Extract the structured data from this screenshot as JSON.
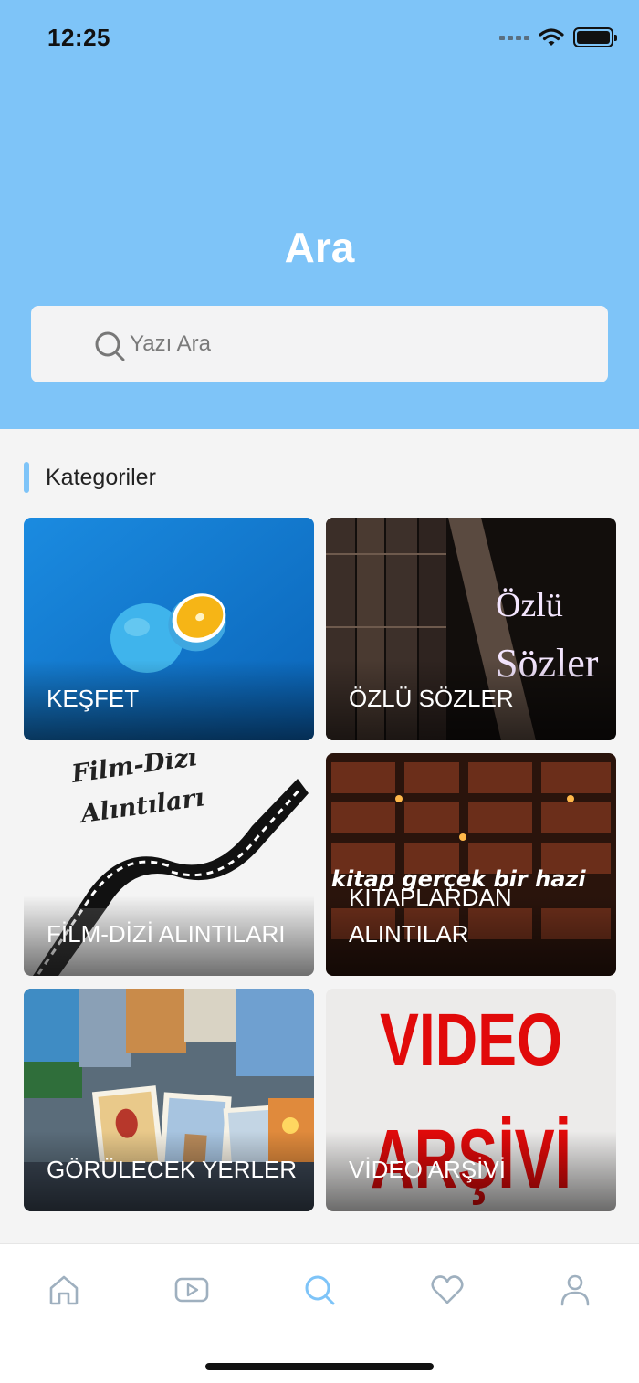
{
  "status_bar": {
    "time": "12:25"
  },
  "header": {
    "title": "Ara"
  },
  "search": {
    "placeholder": "Yazı Ara"
  },
  "categories": {
    "title": "Kategoriler",
    "items": [
      {
        "label": "KEŞFET"
      },
      {
        "label": "ÖZLÜ SÖZLER",
        "art_text_1": "Özlü",
        "art_text_2": "Sözler"
      },
      {
        "label": "FİLM-DİZİ ALINTILARI",
        "art_text_1": "Film-Dizi",
        "art_text_2": "Alıntıları"
      },
      {
        "label": "KİTAPLARDAN ALINTILAR",
        "art_text": "kitap gerçek bir hazi"
      },
      {
        "label": "GÖRÜLECEK YERLER"
      },
      {
        "label": "VİDEO ARŞİVİ",
        "art_text_1": "VIDEO",
        "art_text_2": "ARŞİVİ"
      }
    ]
  },
  "tabbar": {
    "tabs": [
      {
        "icon": "home-icon",
        "active": false
      },
      {
        "icon": "video-icon",
        "active": false
      },
      {
        "icon": "search-icon",
        "active": true
      },
      {
        "icon": "heart-icon",
        "active": false
      },
      {
        "icon": "profile-icon",
        "active": false
      }
    ]
  },
  "colors": {
    "accent": "#7ec4f8",
    "inactive_icon": "#9fb0bf",
    "background": "#f4f4f4"
  }
}
